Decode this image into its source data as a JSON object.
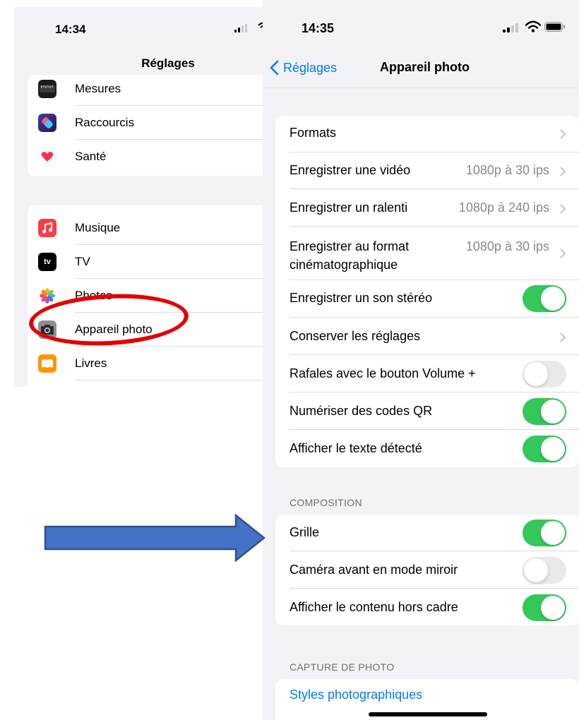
{
  "left_screen": {
    "status_time": "14:34",
    "nav_title": "Réglages",
    "group1": [
      {
        "label": "Mesures",
        "icon": "measure-icon"
      },
      {
        "label": "Raccourcis",
        "icon": "shortcuts-icon"
      },
      {
        "label": "Santé",
        "icon": "health-icon"
      }
    ],
    "group2": [
      {
        "label": "Musique",
        "icon": "music-icon"
      },
      {
        "label": "TV",
        "icon": "tv-icon",
        "icon_text": "tv"
      },
      {
        "label": "Photos",
        "icon": "photos-icon"
      },
      {
        "label": "Appareil photo",
        "icon": "camera-icon"
      },
      {
        "label": "Livres",
        "icon": "books-icon"
      }
    ]
  },
  "right_screen": {
    "status_time": "14:35",
    "back_label": "Réglages",
    "nav_title": "Appareil photo",
    "main_rows": [
      {
        "label": "Formats",
        "value": "",
        "type": "chevron"
      },
      {
        "label": "Enregistrer une vidéo",
        "value": "1080p à 30 ips",
        "type": "chevron"
      },
      {
        "label": "Enregistrer un ralenti",
        "value": "1080p à 240 ips",
        "type": "chevron"
      },
      {
        "label_line1": "Enregistrer au format",
        "label_line2": "cinématographique",
        "value": "1080p à 30 ips",
        "type": "chevron"
      },
      {
        "label": "Enregistrer un son stéréo",
        "type": "toggle",
        "on": true
      },
      {
        "label": "Conserver les réglages",
        "value": "",
        "type": "chevron"
      },
      {
        "label": "Rafales avec le bouton Volume +",
        "type": "toggle",
        "on": false
      },
      {
        "label": "Numériser des codes QR",
        "type": "toggle",
        "on": true
      },
      {
        "label": "Afficher le texte détecté",
        "type": "toggle",
        "on": true
      }
    ],
    "composition_header": "COMPOSITION",
    "composition_rows": [
      {
        "label": "Grille",
        "type": "toggle",
        "on": true
      },
      {
        "label": "Caméra avant en mode miroir",
        "type": "toggle",
        "on": false
      },
      {
        "label": "Afficher le contenu hors cadre",
        "type": "toggle",
        "on": true
      }
    ],
    "capture_header": "CAPTURE DE PHOTO",
    "capture_link": "Styles photographiques"
  },
  "colors": {
    "accent": "#007aff",
    "toggle_on": "#34c759",
    "highlight": "#e30000",
    "arrow_fill": "#4472c4",
    "arrow_stroke": "#2f528f"
  }
}
